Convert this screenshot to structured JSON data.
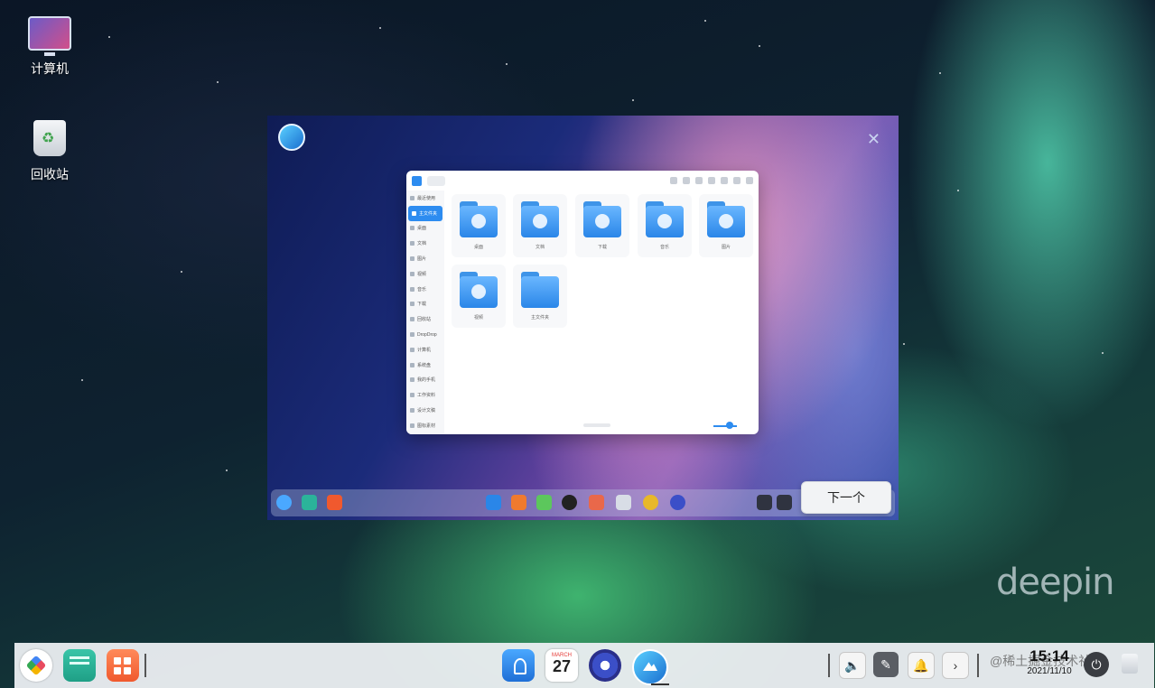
{
  "desktop": {
    "icons": [
      {
        "label": "计算机",
        "icon": "computer-icon"
      },
      {
        "label": "回收站",
        "icon": "trash-icon"
      }
    ],
    "brand": "deepin"
  },
  "welcome_dialog": {
    "close_icon": "close-icon",
    "next_button": "下一个",
    "file_manager_preview": {
      "sidebar": [
        "最近使用",
        "主文件夹",
        "桌面",
        "文档",
        "图片",
        "视频",
        "音乐",
        "下载",
        "回收站",
        "DropDrop",
        "计算机",
        "系统盘",
        "我的手机",
        "工作资料",
        "设计文稿",
        "图标素材"
      ],
      "selected_sidebar_index": 1,
      "folders": [
        "桌面",
        "文档",
        "下载",
        "音乐",
        "图片",
        "视频",
        "主文件夹"
      ]
    }
  },
  "taskbar": {
    "calendar_month": "MARCH",
    "calendar_day": "27",
    "clock_time": "15:14",
    "clock_date": "2021/11/10",
    "watermark": "@稀土掘金技术社区",
    "tray_icons": [
      "volume-icon",
      "pen-icon",
      "notification-icon",
      "arrow-right-icon"
    ],
    "accent": "#2d8cf0"
  }
}
